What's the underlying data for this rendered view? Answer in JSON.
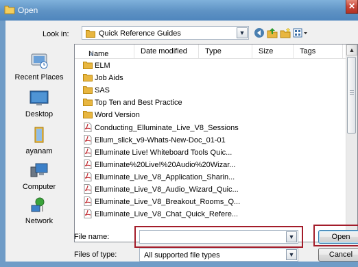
{
  "window": {
    "title": "Open",
    "close_glyph": "✕"
  },
  "toolbar": {
    "look_in_label": "Look in:",
    "look_in_value": "Quick Reference Guides",
    "icons": [
      "back-icon",
      "up-folder-icon",
      "new-folder-icon",
      "views-icon"
    ]
  },
  "places": [
    {
      "label": "Recent Places",
      "icon": "recent-places-icon"
    },
    {
      "label": "Desktop",
      "icon": "desktop-icon"
    },
    {
      "label": "ayanam",
      "icon": "user-folder-icon"
    },
    {
      "label": "Computer",
      "icon": "computer-icon"
    },
    {
      "label": "Network",
      "icon": "network-icon"
    }
  ],
  "columns": {
    "name": "Name",
    "date_modified": "Date modified",
    "type": "Type",
    "size": "Size",
    "tags": "Tags"
  },
  "files": [
    {
      "name": "ELM",
      "kind": "folder"
    },
    {
      "name": "Job Aids",
      "kind": "folder"
    },
    {
      "name": "SAS",
      "kind": "folder"
    },
    {
      "name": "Top Ten and Best Practice",
      "kind": "folder"
    },
    {
      "name": "Word Version",
      "kind": "folder"
    },
    {
      "name": "Conducting_Elluminate_Live_V8_Sessions",
      "kind": "pdf"
    },
    {
      "name": "Ellum_slick_v9-Whats-New-Doc_01-01",
      "kind": "pdf"
    },
    {
      "name": "Elluminate Live! Whiteboard Tools Quic...",
      "kind": "pdf"
    },
    {
      "name": "Elluminate%20Live!%20Audio%20Wizar...",
      "kind": "pdf"
    },
    {
      "name": "Elluminate_Live_V8_Application_Sharin...",
      "kind": "pdf"
    },
    {
      "name": "Elluminate_Live_V8_Audio_Wizard_Quic...",
      "kind": "pdf"
    },
    {
      "name": "Elluminate_Live_V8_Breakout_Rooms_Q...",
      "kind": "pdf"
    },
    {
      "name": "Elluminate_Live_V8_Chat_Quick_Refere...",
      "kind": "pdf"
    }
  ],
  "form": {
    "file_name_label": "File name:",
    "file_name_value": "",
    "files_of_type_label": "Files of type:",
    "files_of_type_value": "All supported file types"
  },
  "buttons": {
    "open": "Open",
    "cancel": "Cancel"
  },
  "colors": {
    "titlebar": "#5e92c4",
    "highlight": "#a31c2a",
    "folder": "#e8b640",
    "pdf": "#c0272d"
  }
}
